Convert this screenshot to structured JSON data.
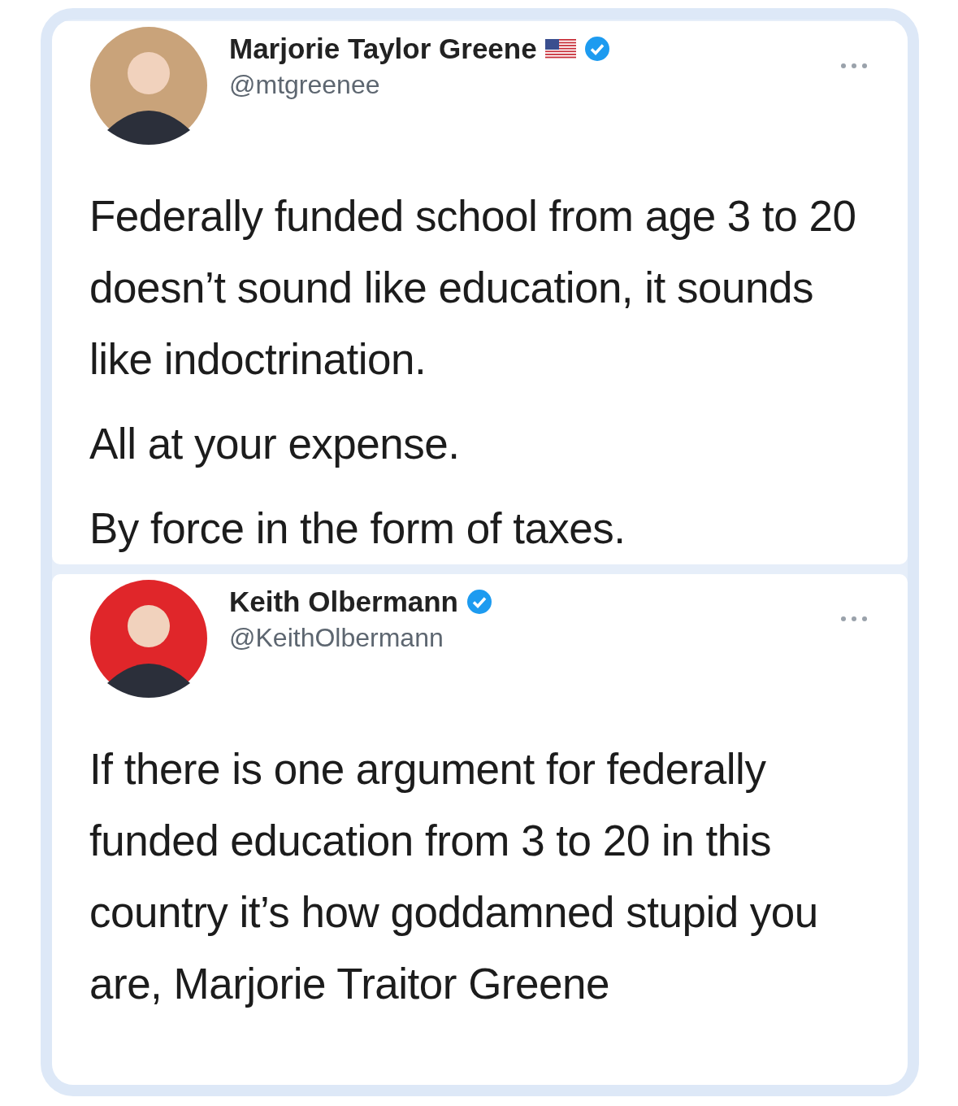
{
  "tweets": [
    {
      "author": {
        "name": "Marjorie Taylor Greene",
        "handle": "@mtgreenee",
        "flag": true,
        "verified": true
      },
      "paragraphs": [
        "Federally funded school from age 3 to 20 doesn’t sound like education, it sounds like indoctrination.",
        "All at your expense.",
        "By force in the form of taxes."
      ]
    },
    {
      "author": {
        "name": "Keith Olbermann",
        "handle": "@KeithOlbermann",
        "flag": false,
        "verified": true
      },
      "paragraphs": [
        "If there is one argument for federally funded education from 3 to 20 in this country it’s how goddamned stupid you are, Marjorie Traitor Greene"
      ]
    }
  ]
}
